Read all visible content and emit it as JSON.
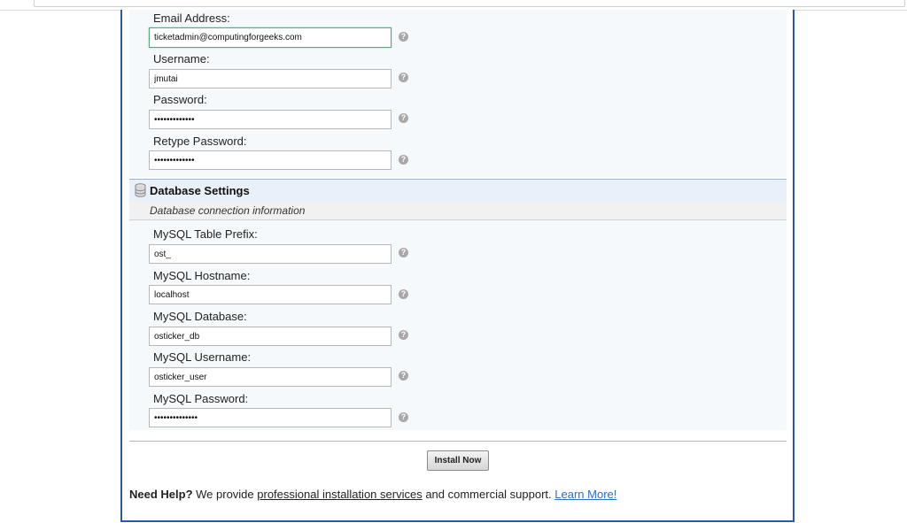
{
  "admin_fields": [
    {
      "label": "Email Address:",
      "value": "ticketadmin@computingforgeeks.com",
      "focused": true
    },
    {
      "label": "Username:",
      "value": "jmutai"
    },
    {
      "label": "Password:",
      "value": "•••••••••••••"
    },
    {
      "label": "Retype Password:",
      "value": "•••••••••••••"
    }
  ],
  "database": {
    "title": "Database Settings",
    "subtitle": "Database connection information",
    "fields": [
      {
        "label": "MySQL Table Prefix:",
        "value": "ost_"
      },
      {
        "label": "MySQL Hostname:",
        "value": "localhost"
      },
      {
        "label": "MySQL Database:",
        "value": "osticker_db"
      },
      {
        "label": "MySQL Username:",
        "value": "osticker_user"
      },
      {
        "label": "MySQL Password:",
        "value": "••••••••••••••"
      }
    ]
  },
  "help_glyph": "?",
  "install_button": "Install Now",
  "help": {
    "lead": "Need Help?",
    "text1": " We provide ",
    "link1": "professional installation services",
    "text2": " and commercial support. ",
    "link2": "Learn More!"
  },
  "colors": {
    "accent": "#2c5aa0",
    "link": "#2a6fc0",
    "focus": "#5aa886"
  },
  "icons": {
    "section": "database-icon",
    "help": "help-question-icon"
  }
}
